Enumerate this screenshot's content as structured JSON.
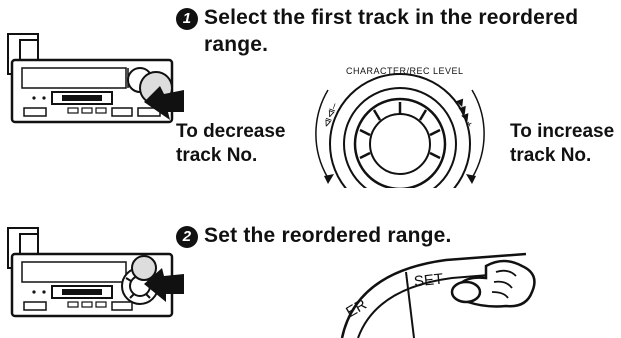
{
  "step1": {
    "number": "1",
    "title_line1": "Select the first track in the reordered",
    "title_line2": "range."
  },
  "step2": {
    "number": "2",
    "title": "Set the reordered range."
  },
  "dial": {
    "label": "CHARACTER/REC LEVEL",
    "left_symbol": "⧏⧏–",
    "right_symbol": "▶▶▶+"
  },
  "labels": {
    "decrease": "To decrease\ntrack No.",
    "increase": "To increase\ntrack No."
  },
  "set_button": {
    "label": "SET",
    "partial_label": "ER"
  },
  "icons": [
    "device-illustration",
    "pointer-arrow-icon",
    "jog-dial-illustration",
    "pressing-finger-icon"
  ],
  "colors": {
    "ink": "#111111",
    "background": "#ffffff"
  }
}
